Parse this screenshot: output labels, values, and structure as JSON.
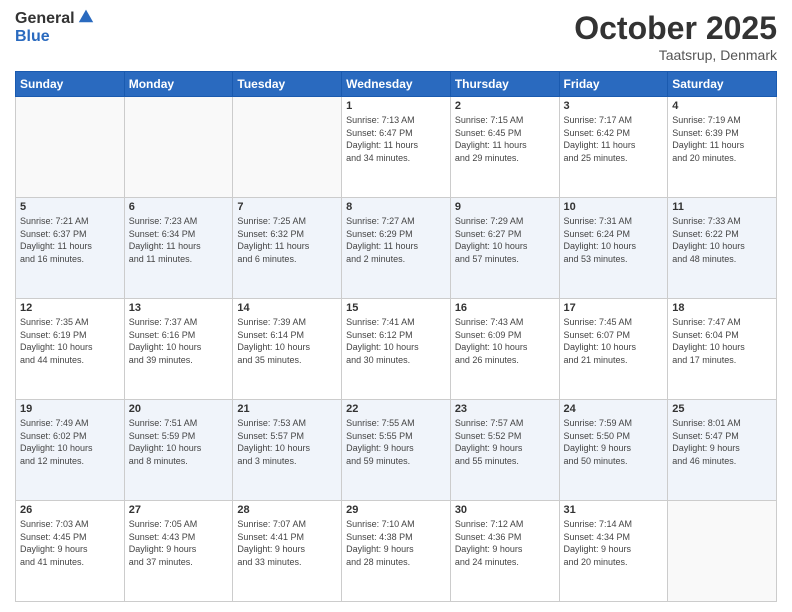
{
  "header": {
    "logo_general": "General",
    "logo_blue": "Blue",
    "title": "October 2025",
    "location": "Taatsrup, Denmark"
  },
  "days_of_week": [
    "Sunday",
    "Monday",
    "Tuesday",
    "Wednesday",
    "Thursday",
    "Friday",
    "Saturday"
  ],
  "weeks": [
    [
      {
        "day": "",
        "info": ""
      },
      {
        "day": "",
        "info": ""
      },
      {
        "day": "",
        "info": ""
      },
      {
        "day": "1",
        "info": "Sunrise: 7:13 AM\nSunset: 6:47 PM\nDaylight: 11 hours\nand 34 minutes."
      },
      {
        "day": "2",
        "info": "Sunrise: 7:15 AM\nSunset: 6:45 PM\nDaylight: 11 hours\nand 29 minutes."
      },
      {
        "day": "3",
        "info": "Sunrise: 7:17 AM\nSunset: 6:42 PM\nDaylight: 11 hours\nand 25 minutes."
      },
      {
        "day": "4",
        "info": "Sunrise: 7:19 AM\nSunset: 6:39 PM\nDaylight: 11 hours\nand 20 minutes."
      }
    ],
    [
      {
        "day": "5",
        "info": "Sunrise: 7:21 AM\nSunset: 6:37 PM\nDaylight: 11 hours\nand 16 minutes."
      },
      {
        "day": "6",
        "info": "Sunrise: 7:23 AM\nSunset: 6:34 PM\nDaylight: 11 hours\nand 11 minutes."
      },
      {
        "day": "7",
        "info": "Sunrise: 7:25 AM\nSunset: 6:32 PM\nDaylight: 11 hours\nand 6 minutes."
      },
      {
        "day": "8",
        "info": "Sunrise: 7:27 AM\nSunset: 6:29 PM\nDaylight: 11 hours\nand 2 minutes."
      },
      {
        "day": "9",
        "info": "Sunrise: 7:29 AM\nSunset: 6:27 PM\nDaylight: 10 hours\nand 57 minutes."
      },
      {
        "day": "10",
        "info": "Sunrise: 7:31 AM\nSunset: 6:24 PM\nDaylight: 10 hours\nand 53 minutes."
      },
      {
        "day": "11",
        "info": "Sunrise: 7:33 AM\nSunset: 6:22 PM\nDaylight: 10 hours\nand 48 minutes."
      }
    ],
    [
      {
        "day": "12",
        "info": "Sunrise: 7:35 AM\nSunset: 6:19 PM\nDaylight: 10 hours\nand 44 minutes."
      },
      {
        "day": "13",
        "info": "Sunrise: 7:37 AM\nSunset: 6:16 PM\nDaylight: 10 hours\nand 39 minutes."
      },
      {
        "day": "14",
        "info": "Sunrise: 7:39 AM\nSunset: 6:14 PM\nDaylight: 10 hours\nand 35 minutes."
      },
      {
        "day": "15",
        "info": "Sunrise: 7:41 AM\nSunset: 6:12 PM\nDaylight: 10 hours\nand 30 minutes."
      },
      {
        "day": "16",
        "info": "Sunrise: 7:43 AM\nSunset: 6:09 PM\nDaylight: 10 hours\nand 26 minutes."
      },
      {
        "day": "17",
        "info": "Sunrise: 7:45 AM\nSunset: 6:07 PM\nDaylight: 10 hours\nand 21 minutes."
      },
      {
        "day": "18",
        "info": "Sunrise: 7:47 AM\nSunset: 6:04 PM\nDaylight: 10 hours\nand 17 minutes."
      }
    ],
    [
      {
        "day": "19",
        "info": "Sunrise: 7:49 AM\nSunset: 6:02 PM\nDaylight: 10 hours\nand 12 minutes."
      },
      {
        "day": "20",
        "info": "Sunrise: 7:51 AM\nSunset: 5:59 PM\nDaylight: 10 hours\nand 8 minutes."
      },
      {
        "day": "21",
        "info": "Sunrise: 7:53 AM\nSunset: 5:57 PM\nDaylight: 10 hours\nand 3 minutes."
      },
      {
        "day": "22",
        "info": "Sunrise: 7:55 AM\nSunset: 5:55 PM\nDaylight: 9 hours\nand 59 minutes."
      },
      {
        "day": "23",
        "info": "Sunrise: 7:57 AM\nSunset: 5:52 PM\nDaylight: 9 hours\nand 55 minutes."
      },
      {
        "day": "24",
        "info": "Sunrise: 7:59 AM\nSunset: 5:50 PM\nDaylight: 9 hours\nand 50 minutes."
      },
      {
        "day": "25",
        "info": "Sunrise: 8:01 AM\nSunset: 5:47 PM\nDaylight: 9 hours\nand 46 minutes."
      }
    ],
    [
      {
        "day": "26",
        "info": "Sunrise: 7:03 AM\nSunset: 4:45 PM\nDaylight: 9 hours\nand 41 minutes."
      },
      {
        "day": "27",
        "info": "Sunrise: 7:05 AM\nSunset: 4:43 PM\nDaylight: 9 hours\nand 37 minutes."
      },
      {
        "day": "28",
        "info": "Sunrise: 7:07 AM\nSunset: 4:41 PM\nDaylight: 9 hours\nand 33 minutes."
      },
      {
        "day": "29",
        "info": "Sunrise: 7:10 AM\nSunset: 4:38 PM\nDaylight: 9 hours\nand 28 minutes."
      },
      {
        "day": "30",
        "info": "Sunrise: 7:12 AM\nSunset: 4:36 PM\nDaylight: 9 hours\nand 24 minutes."
      },
      {
        "day": "31",
        "info": "Sunrise: 7:14 AM\nSunset: 4:34 PM\nDaylight: 9 hours\nand 20 minutes."
      },
      {
        "day": "",
        "info": ""
      }
    ]
  ]
}
